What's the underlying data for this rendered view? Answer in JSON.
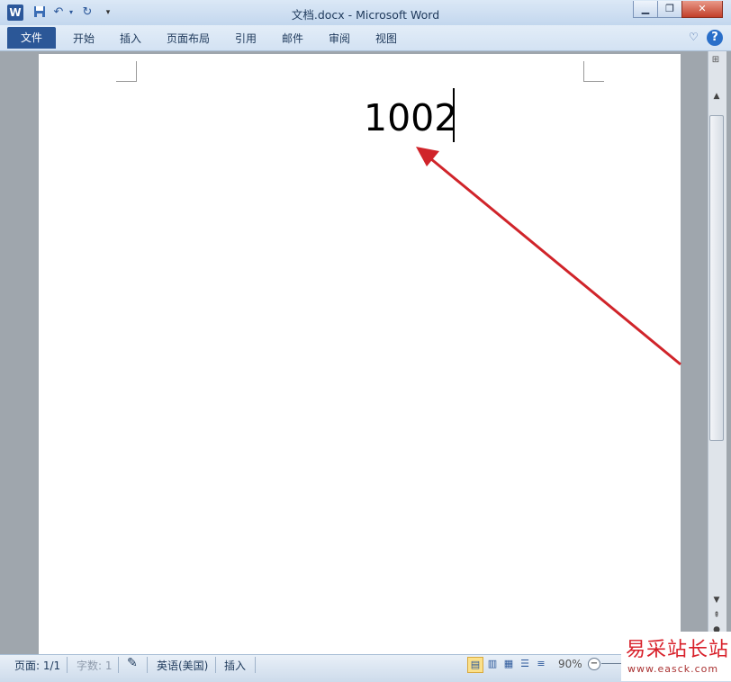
{
  "window": {
    "title": "文档.docx - Microsoft Word",
    "app_icon_letter": "W",
    "controls": {
      "minimize": "▁",
      "restore": "❐",
      "close": "✕"
    },
    "quick_access": {
      "save_icon": "save-icon",
      "undo_icon": "undo-icon",
      "redo_icon": "redo-icon",
      "customize_icon": "customize-icon"
    }
  },
  "ribbon": {
    "file_tab": "文件",
    "tabs": [
      "开始",
      "插入",
      "页面布局",
      "引用",
      "邮件",
      "审阅",
      "视图"
    ],
    "help": "?",
    "minimize_glyph": "♡"
  },
  "document": {
    "text": "1002"
  },
  "statusbar": {
    "page": "页面: 1/1",
    "words": "字数: 1",
    "language": "英语(美国)",
    "mode": "插入",
    "zoom": "90%"
  },
  "watermark": {
    "title": "易采站长站",
    "url": "www.easck.com"
  },
  "colors": {
    "file_tab": "#2b5797",
    "annotation_arrow": "#d0242a"
  }
}
